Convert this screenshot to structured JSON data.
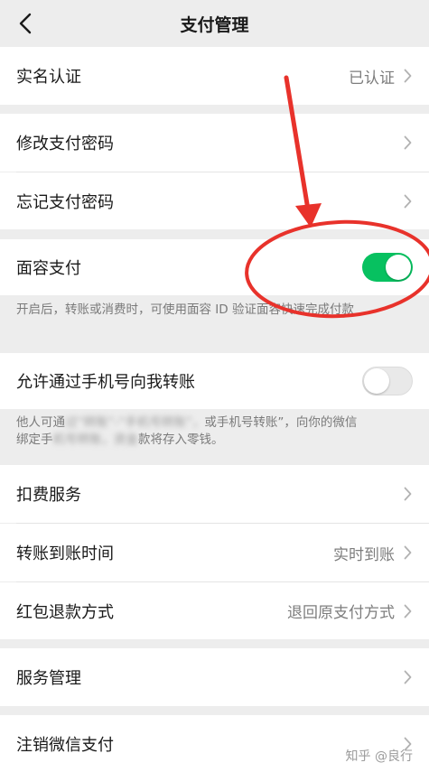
{
  "header": {
    "title": "支付管理"
  },
  "rows": {
    "real_name": {
      "label": "实名认证",
      "value": "已认证"
    },
    "change_password": {
      "label": "修改支付密码"
    },
    "forgot_password": {
      "label": "忘记支付密码"
    },
    "face_pay": {
      "label": "面容支付",
      "enabled": true,
      "description": "开启后，转账或消费时，可使用面容 ID 验证面容快速完成付款"
    },
    "phone_transfer": {
      "label": "允许通过手机号向我转账",
      "enabled": false,
      "description_line1_visible": "他人可通",
      "description_line1_blurred": "过“转账”-“手机号转账”，",
      "description_line1_tail": "或手机号转账”，向你的微信",
      "description_line2_visible": "绑定手",
      "description_line2_blurred": "机号转账，资金",
      "description_line2_tail": "款将存入零钱。"
    },
    "deduction": {
      "label": "扣费服务"
    },
    "arrival_time": {
      "label": "转账到账时间",
      "value": "实时到账"
    },
    "refund_method": {
      "label": "红包退款方式",
      "value": "退回原支付方式"
    },
    "service_manage": {
      "label": "服务管理"
    },
    "cancel_pay": {
      "label": "注销微信支付"
    }
  },
  "watermark": "知乎 @良行",
  "colors": {
    "accent_green": "#07c160",
    "annotation_red": "#e8322b",
    "background": "#ededed"
  }
}
